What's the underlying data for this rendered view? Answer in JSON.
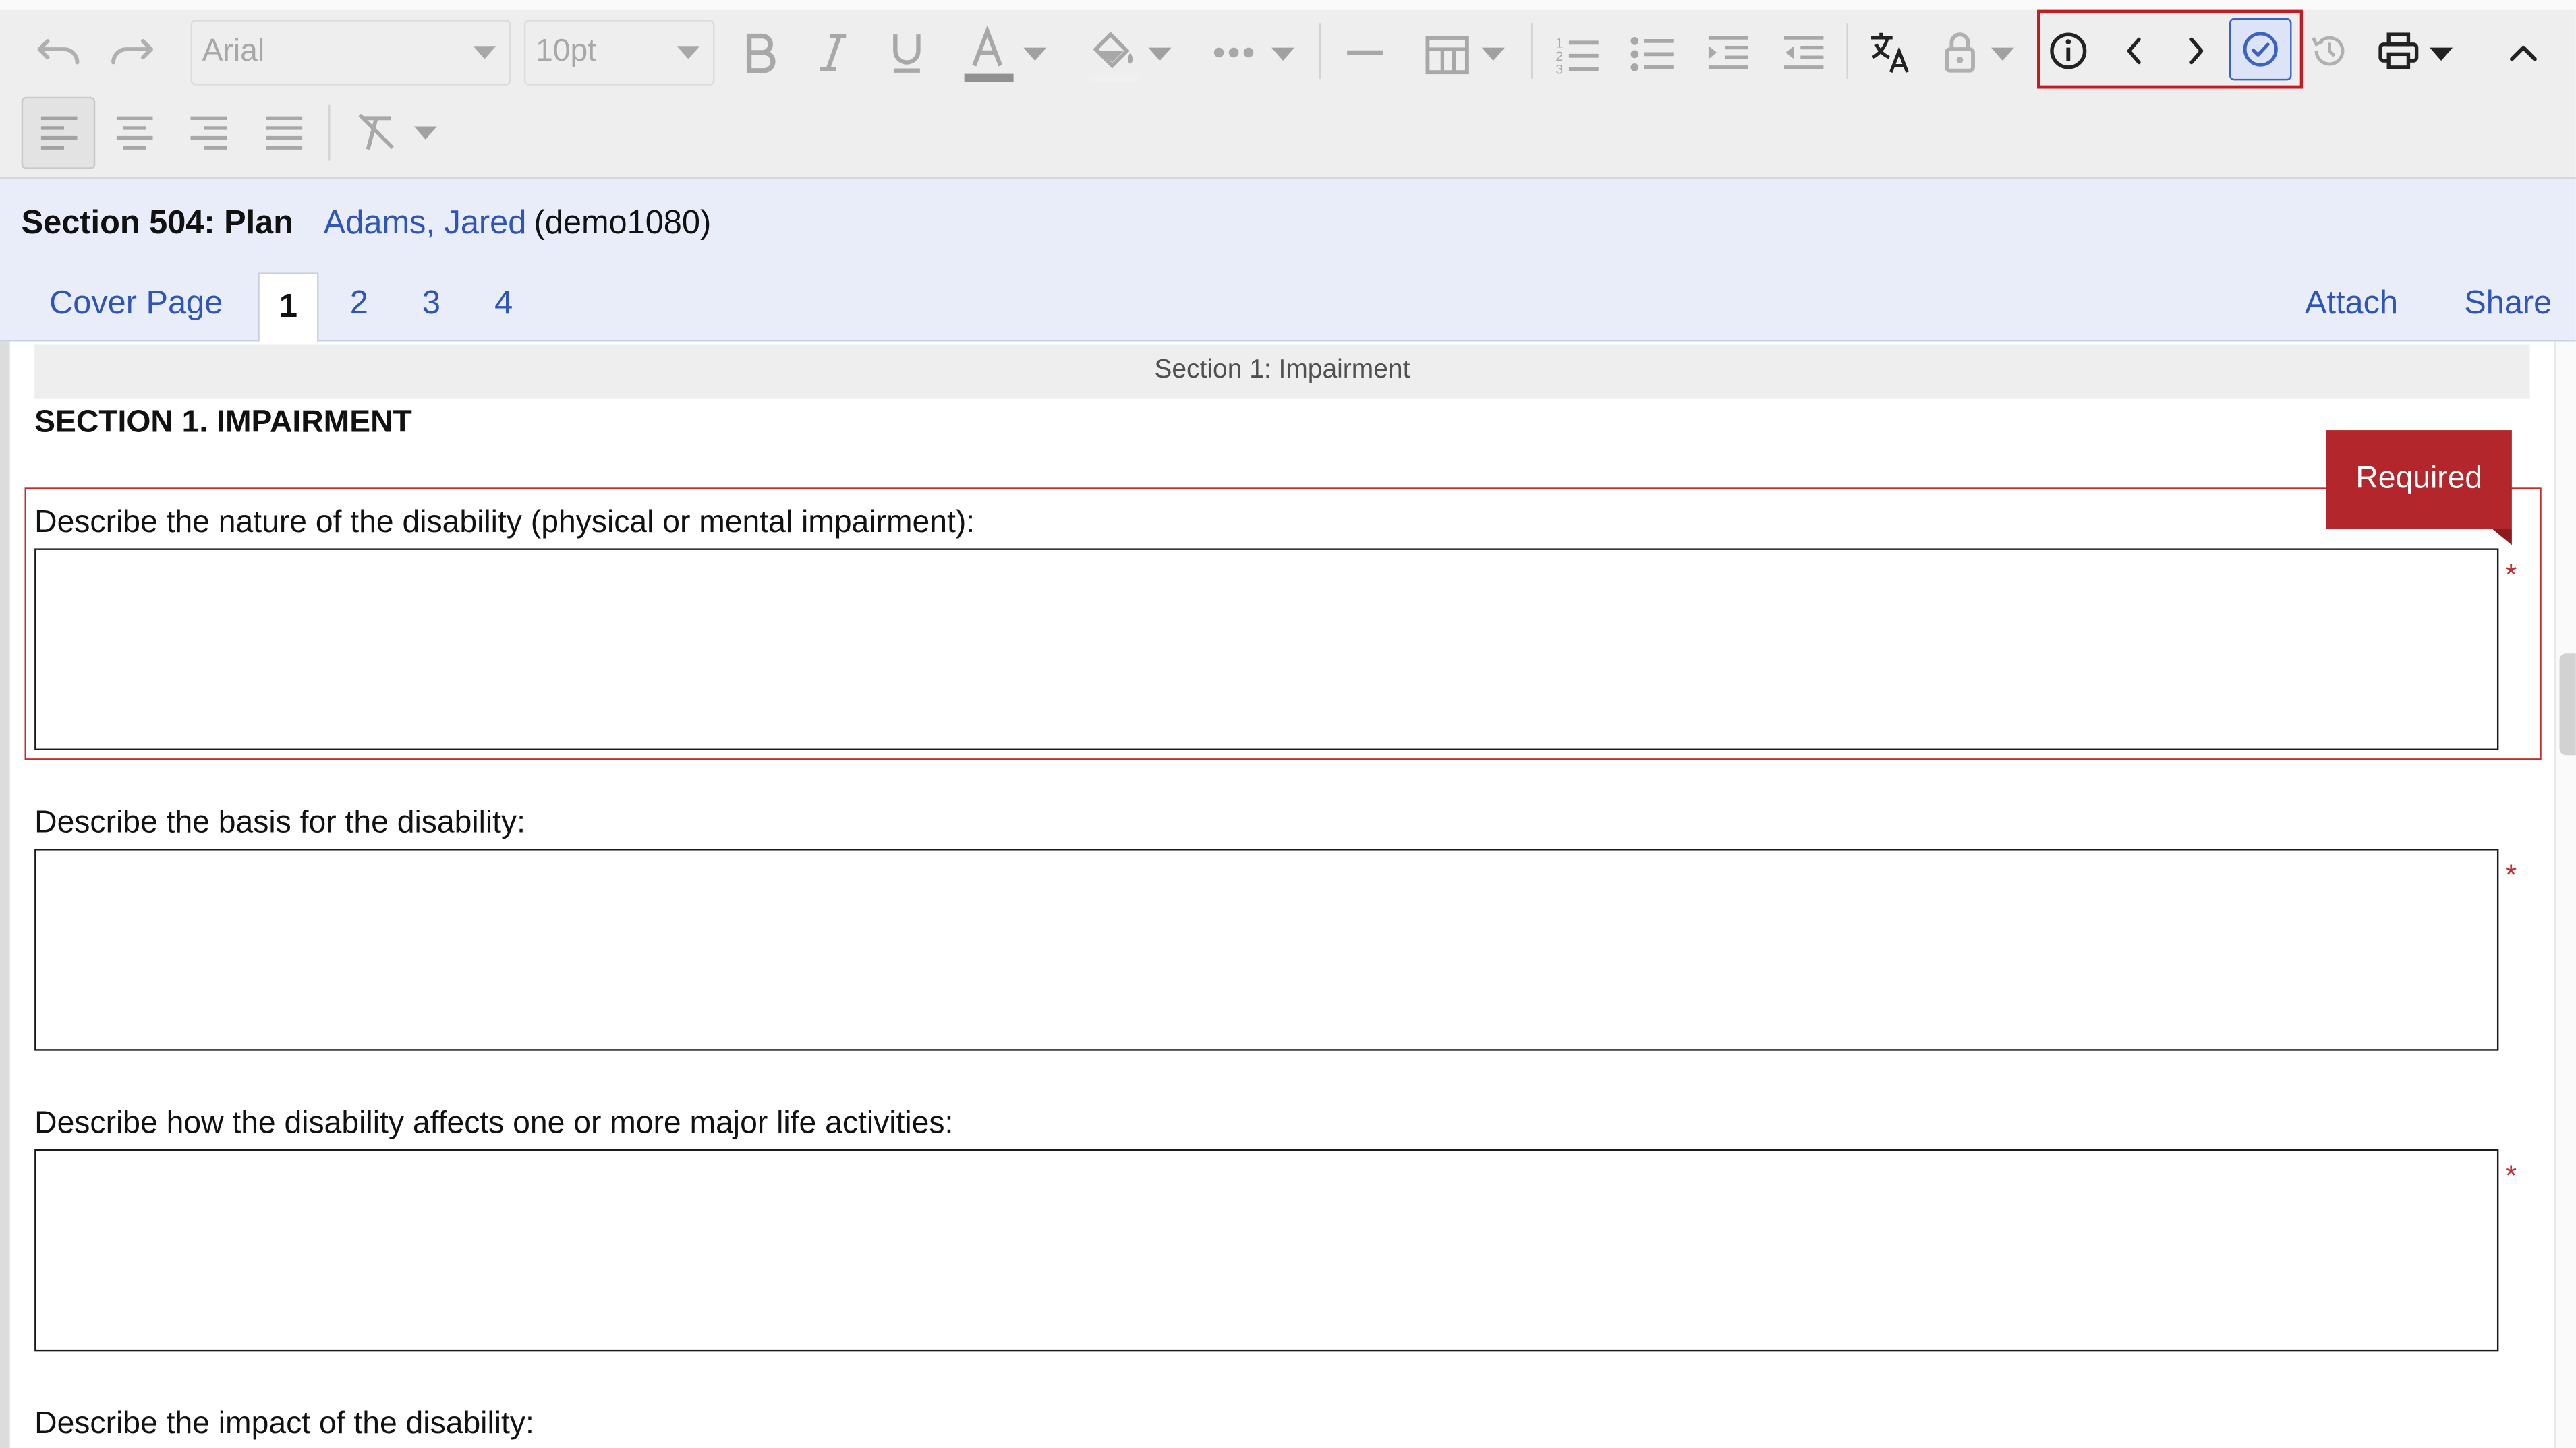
{
  "toolbar": {
    "font_family_value": "Arial",
    "font_size_value": "10pt",
    "buttons": {
      "undo": "undo-icon",
      "redo": "redo-icon",
      "bold": "bold-icon",
      "italic": "italic-icon",
      "underline": "underline-icon",
      "text_color": "text-color-icon",
      "highlight": "fill-color-icon",
      "more": "more-options-icon",
      "horizontal_rule": "horizontal-line-icon",
      "table": "table-icon",
      "numbered_list": "numbered-list-icon",
      "bullet_list": "bullet-list-icon",
      "indent": "indent-icon",
      "outdent": "outdent-icon",
      "translate": "translate-icon",
      "lock": "lock-icon",
      "info": "info-icon",
      "previous": "chevron-left-icon",
      "next": "chevron-right-icon",
      "validate": "check-circle-icon",
      "history": "history-icon",
      "print": "printer-icon",
      "collapse": "chevron-up-icon",
      "align_left": "align-left-icon",
      "align_center": "align-center-icon",
      "align_right": "align-right-icon",
      "align_justify": "align-justify-icon",
      "clear_format": "clear-format-icon"
    },
    "colors": {
      "highlight_border": "#c21b24",
      "active_button_bg": "#dde4f7",
      "active_button_icon": "#3b63c4"
    }
  },
  "header": {
    "title": "Section 504: Plan",
    "student_name": "Adams, Jared",
    "student_id": "(demo1080)",
    "tabs": [
      "Cover Page",
      "1",
      "2",
      "3",
      "4"
    ],
    "active_tab": "1",
    "actions": {
      "attach": "Attach",
      "share": "Share"
    }
  },
  "content": {
    "section_band": "Section 1: Impairment",
    "section_heading": "SECTION 1. IMPAIRMENT",
    "required_flag": "Required",
    "required_marker": "*",
    "questions": [
      {
        "label": "Describe the nature of the disability (physical or mental impairment):",
        "value": ""
      },
      {
        "label": "Describe the basis for the disability:",
        "value": ""
      },
      {
        "label": "Describe how the disability affects one or more major life activities:",
        "value": ""
      },
      {
        "label": "Describe the impact of the disability:",
        "value": ""
      }
    ]
  },
  "colors": {
    "link": "#2f55b8",
    "required": "#b3262b",
    "header_bg": "#e8edf9",
    "toolbar_bg": "#eeeeee"
  }
}
